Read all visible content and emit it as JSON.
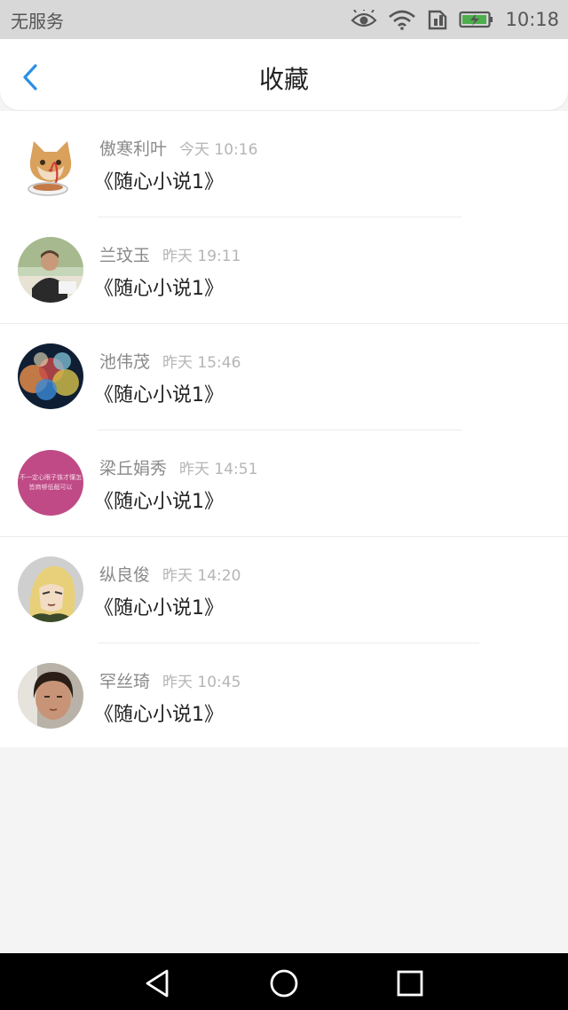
{
  "status_bar": {
    "carrier": "无服务",
    "time": "10:18",
    "icons": [
      "eye-icon",
      "wifi-icon",
      "sim-icon",
      "battery-charging-icon"
    ]
  },
  "header": {
    "back_icon": "chevron-left-icon",
    "title": "收藏"
  },
  "favorites": [
    {
      "name": "傲寒利叶",
      "time": "今天 10:16",
      "book": "《随心小说1》",
      "avatar": "cat-avatar"
    },
    {
      "name": "兰玟玉",
      "time": "昨天 19:11",
      "book": "《随心小说1》",
      "avatar": "person-avatar"
    },
    {
      "name": "池伟茂",
      "time": "昨天 15:46",
      "book": "《随心小说1》",
      "avatar": "bokeh-avatar"
    },
    {
      "name": "梁丘娟秀",
      "time": "昨天 14:51",
      "book": "《随心小说1》",
      "avatar": "text-avatar"
    },
    {
      "name": "纵良俊",
      "time": "昨天 14:20",
      "book": "《随心小说1》",
      "avatar": "anime-avatar"
    },
    {
      "name": "罕丝琦",
      "time": "昨天 10:45",
      "book": "《随心小说1》",
      "avatar": "selfie-avatar"
    }
  ],
  "avatar_text": "不一定心眼子铢才懂怎 皆商够低截可以",
  "nav": {
    "icons": [
      "back-triangle-icon",
      "home-circle-icon",
      "recents-square-icon"
    ]
  },
  "colors": {
    "accent": "#2b8fe6",
    "background": "#f4f4f4",
    "avatar_pink": "#c04a86"
  }
}
